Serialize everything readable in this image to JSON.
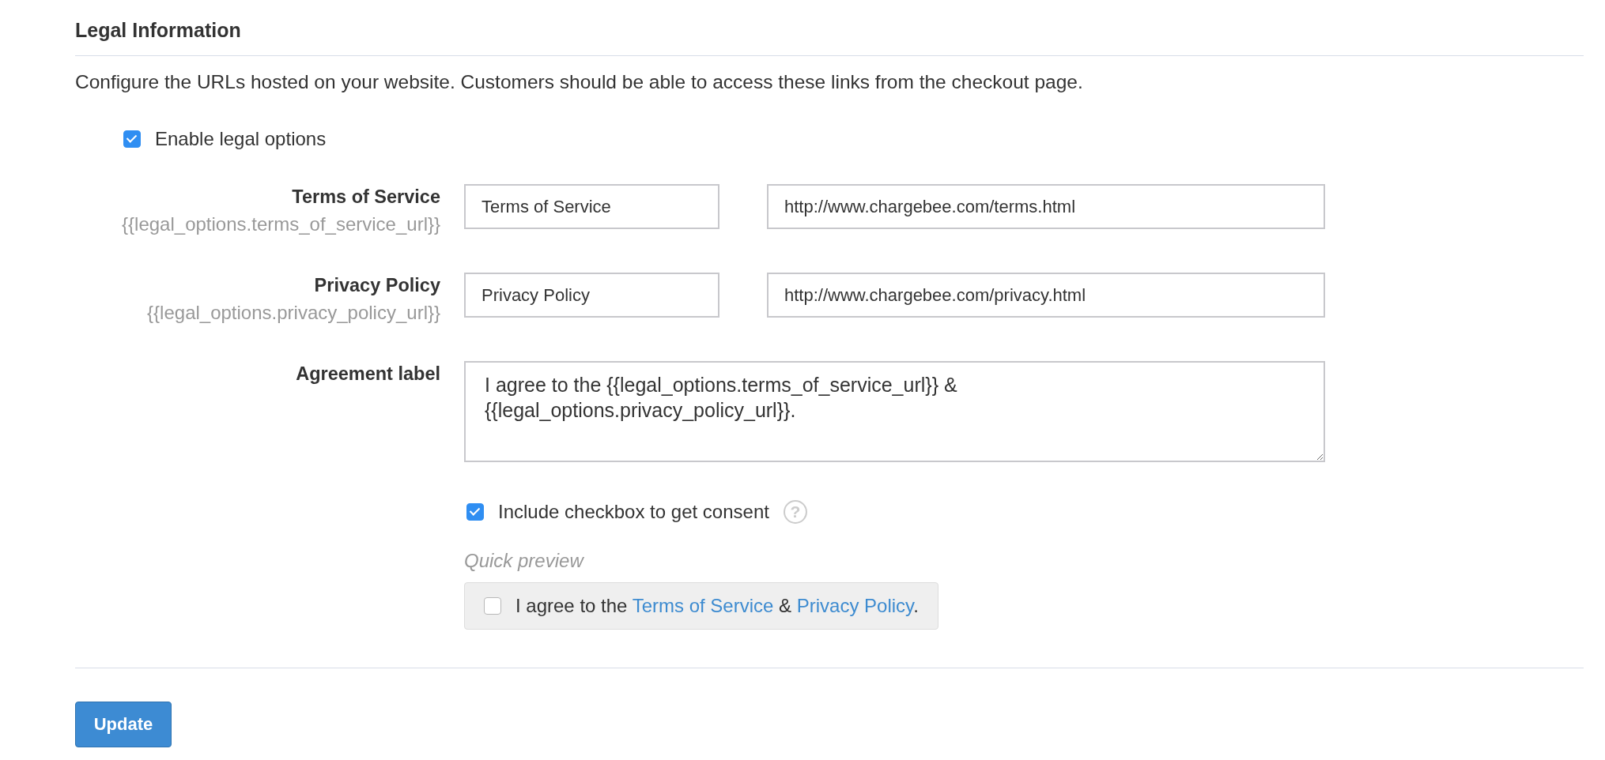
{
  "section": {
    "title": "Legal Information",
    "description": "Configure the URLs hosted on your website. Customers should be able to access these links from the checkout page."
  },
  "enable_legal": {
    "label": "Enable legal options",
    "checked": true
  },
  "link_rows": [
    {
      "label": "Terms of Service",
      "hint": "{{legal_options.terms_of_service_url}}",
      "name_value": "Terms of Service",
      "url_value": "http://www.chargebee.com/terms.html"
    },
    {
      "label": "Privacy Policy",
      "hint": "{{legal_options.privacy_policy_url}}",
      "name_value": "Privacy Policy",
      "url_value": "http://www.chargebee.com/privacy.html"
    }
  ],
  "agreement": {
    "label": "Agreement label",
    "value": "I agree to the {{legal_options.terms_of_service_url}} & \n{{legal_options.privacy_policy_url}}."
  },
  "consent": {
    "label": "Include checkbox to get consent",
    "checked": true,
    "help": "?"
  },
  "preview": {
    "title": "Quick preview",
    "checked": false,
    "text_before": "I agree to the ",
    "link_1": "Terms of Service",
    "text_middle": " & ",
    "link_2": "Privacy Policy",
    "text_after": "."
  },
  "buttons": [
    {
      "label": "Update"
    }
  ]
}
